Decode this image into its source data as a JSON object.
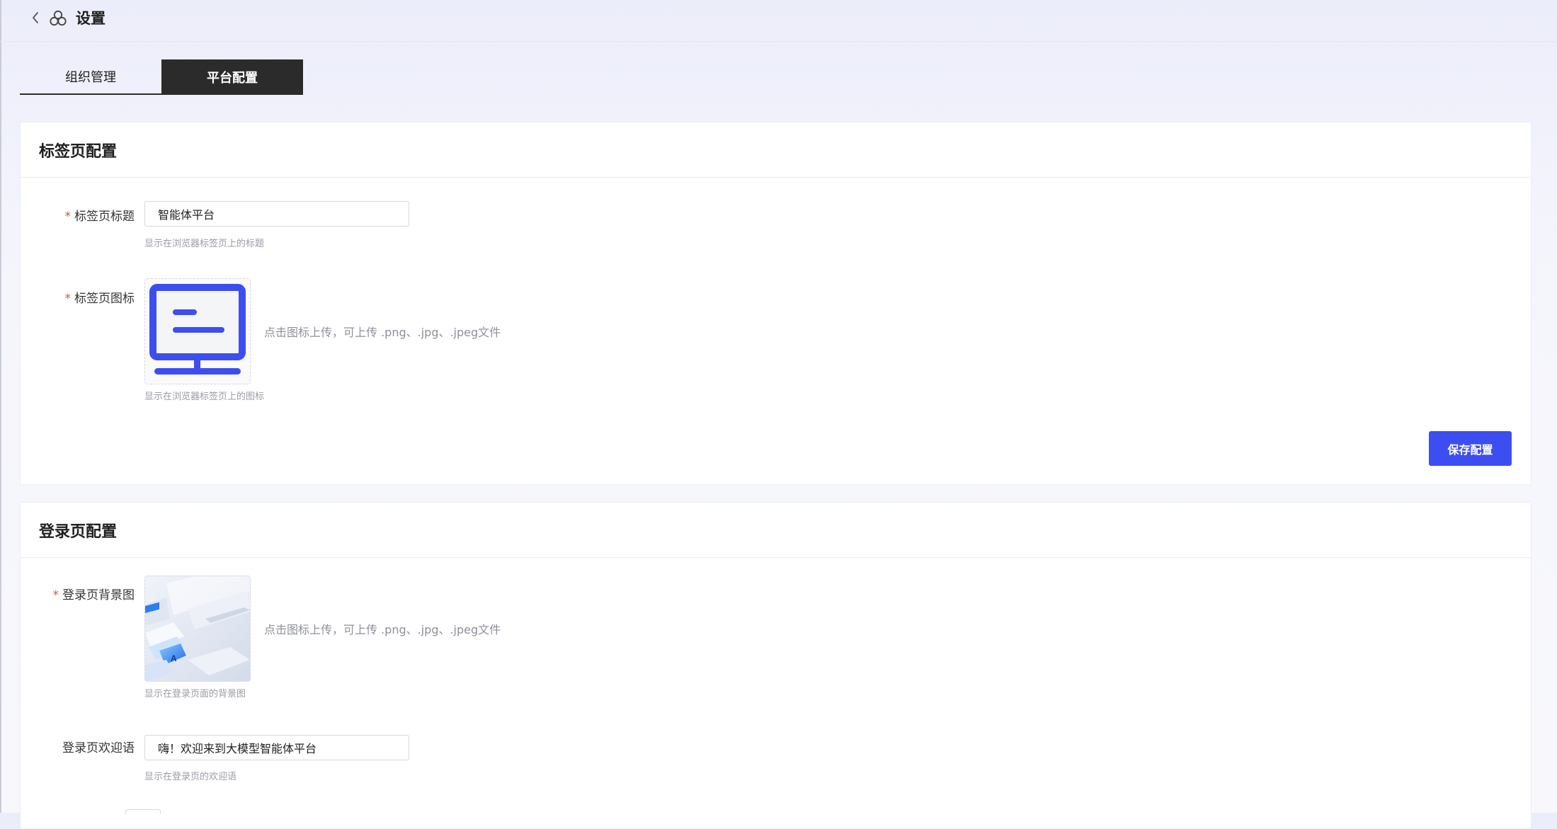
{
  "header": {
    "title": "设置"
  },
  "tabs": [
    {
      "label": "组织管理",
      "active": false
    },
    {
      "label": "平台配置",
      "active": true
    }
  ],
  "tab_config": {
    "section_title": "标签页配置",
    "title_field": {
      "label": "标签页标题",
      "required_mark": "*",
      "value": "智能体平台",
      "hint": "显示在浏览器标签页上的标题"
    },
    "icon_field": {
      "label": "标签页图标",
      "required_mark": "*",
      "upload_tip": "点击图标上传，可上传 .png、.jpg、.jpeg文件",
      "hint": "显示在浏览器标签页上的图标"
    },
    "save_label": "保存配置"
  },
  "login_config": {
    "section_title": "登录页配置",
    "background_field": {
      "label": "登录页背景图",
      "required_mark": "*",
      "upload_tip": "点击图标上传，可上传 .png、.jpg、.jpeg文件",
      "hint": "显示在登录页面的背景图"
    },
    "welcome_field": {
      "label": "登录页欢迎语",
      "value": "嗨！欢迎来到大模型智能体平台",
      "hint": "显示在登录页的欢迎语"
    }
  },
  "colors": {
    "accent": "#3d4ef0",
    "tab_active_bg": "#2b2b2b",
    "required": "#e5484d"
  },
  "icons": {
    "back": "chevron-left-icon",
    "app": "settings-cluster-icon",
    "favicon": "monitor-icon"
  }
}
